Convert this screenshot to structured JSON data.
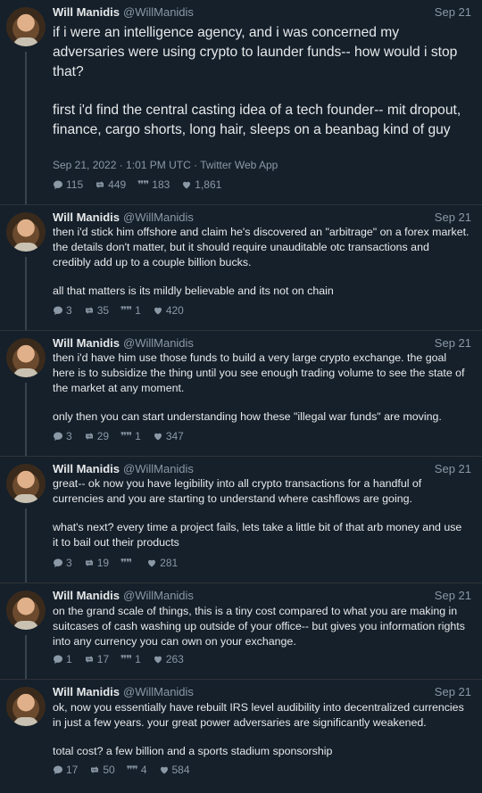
{
  "tweets": [
    {
      "name": "Will Manidis",
      "handle": "@WillManidis",
      "date": "Sep 21",
      "paragraphs": [
        "if i were an intelligence agency, and i was concerned my adversaries were using crypto to launder funds-- how would i stop that?",
        "first i'd find the central casting idea of a tech founder-- mit dropout, finance, cargo shorts, long hair, sleeps on a beanbag kind of guy"
      ],
      "timestamp": "Sep 21, 2022 · 1:01 PM UTC · Twitter Web App",
      "replies": "115",
      "retweets": "449",
      "quotes": "183",
      "likes": "1,861"
    },
    {
      "name": "Will Manidis",
      "handle": "@WillManidis",
      "date": "Sep 21",
      "paragraphs": [
        "then i'd stick him offshore and claim he's discovered an \"arbitrage\" on a forex market. the details don't matter, but it should require unauditable otc transactions and credibly add up to a couple billion bucks.",
        "all that matters is its mildly believable and its not on chain"
      ],
      "replies": "3",
      "retweets": "35",
      "quotes": "1",
      "likes": "420"
    },
    {
      "name": "Will Manidis",
      "handle": "@WillManidis",
      "date": "Sep 21",
      "paragraphs": [
        "then i'd have him use those funds to build a very large crypto exchange. the goal here is to subsidize the thing until you see enough trading volume to see the state of the market at any moment.",
        "only then you can start understanding how these \"illegal war funds\" are moving."
      ],
      "replies": "3",
      "retweets": "29",
      "quotes": "1",
      "likes": "347"
    },
    {
      "name": "Will Manidis",
      "handle": "@WillManidis",
      "date": "Sep 21",
      "paragraphs": [
        "great-- ok now you have legibility into all crypto transactions for a handful of currencies and you are starting to understand where cashflows are going.",
        "what's next? every time a project fails, lets take a little bit of that arb money and use it to bail out their products"
      ],
      "replies": "3",
      "retweets": "19",
      "quotes": "",
      "likes": "281"
    },
    {
      "name": "Will Manidis",
      "handle": "@WillManidis",
      "date": "Sep 21",
      "paragraphs": [
        "on the grand scale of things, this is a tiny cost compared to what you are making in suitcases of cash washing up outside of your office-- but gives you information rights into any currency you can own on your exchange."
      ],
      "replies": "1",
      "retweets": "17",
      "quotes": "1",
      "likes": "263"
    },
    {
      "name": "Will Manidis",
      "handle": "@WillManidis",
      "date": "Sep 21",
      "paragraphs": [
        "ok, now you essentially have rebuilt IRS level audibility into decentralized currencies in just a few years. your great power adversaries are significantly weakened.",
        "total cost? a few billion and a sports stadium sponsorship"
      ],
      "replies": "17",
      "retweets": "50",
      "quotes": "4",
      "likes": "584"
    }
  ]
}
